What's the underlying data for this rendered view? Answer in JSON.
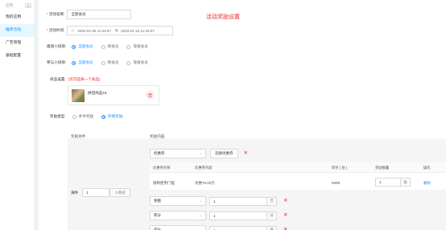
{
  "sidebar": {
    "title": "应用",
    "collapse_icon": "☰",
    "items": [
      {
        "label": "我的应用",
        "active": false
      },
      {
        "label": "推荐活动",
        "active": true
      },
      {
        "label": "广告管理",
        "active": false
      },
      {
        "label": "基础配置",
        "active": false
      }
    ]
  },
  "page": {
    "title": "活动奖励设置"
  },
  "form": {
    "activity_name": {
      "label": "活动名称",
      "value": "全部会员"
    },
    "activity_time": {
      "label": "活动时间",
      "start": "2022-01-08 11:34:57",
      "end": "2022-01-15 11:34:57"
    },
    "inviter_perm": {
      "label": "邀请人权限",
      "options": [
        "全部会员",
        "新会员",
        "等级会员"
      ],
      "selected": 0
    },
    "participant_perm": {
      "label": "参与人权限",
      "options": [
        "全部会员",
        "新会员",
        "等级会员"
      ],
      "selected": 0
    },
    "goods": {
      "label": "商品设置",
      "hint": "(仅可选择一个商品)",
      "name": "拼团商品15"
    },
    "reward_type": {
      "label": "奖励类型",
      "options": [
        "条件奖励",
        "阶梯奖励"
      ],
      "selected": 1
    }
  },
  "rules": {
    "col_condition": "奖励条件",
    "col_content": "奖励内容",
    "condition_prefix": "满件",
    "condition_value": "1",
    "condition_unit": "人购买",
    "reward_select": "优惠券",
    "choose_coupon_btn": "选择优惠券",
    "coupon_table": {
      "headers": [
        "优惠券名称",
        "优惠券内容",
        "库存 ( 张 )",
        "奖励数量",
        "操作"
      ],
      "row": {
        "name": "限制使用门槛",
        "content": "优惠78.00元",
        "stock": "9999",
        "qty": "1",
        "qty_unit": "张",
        "action": "删除"
      }
    },
    "extra_rows": [
      {
        "type": "余额",
        "value": "1",
        "unit": "元"
      },
      {
        "type": "积分",
        "value": "1",
        "unit": "分"
      },
      {
        "type": "成长",
        "value": "1",
        "unit": "值"
      }
    ]
  },
  "colors": {
    "primary": "#1890ff",
    "danger": "#f5222d"
  }
}
